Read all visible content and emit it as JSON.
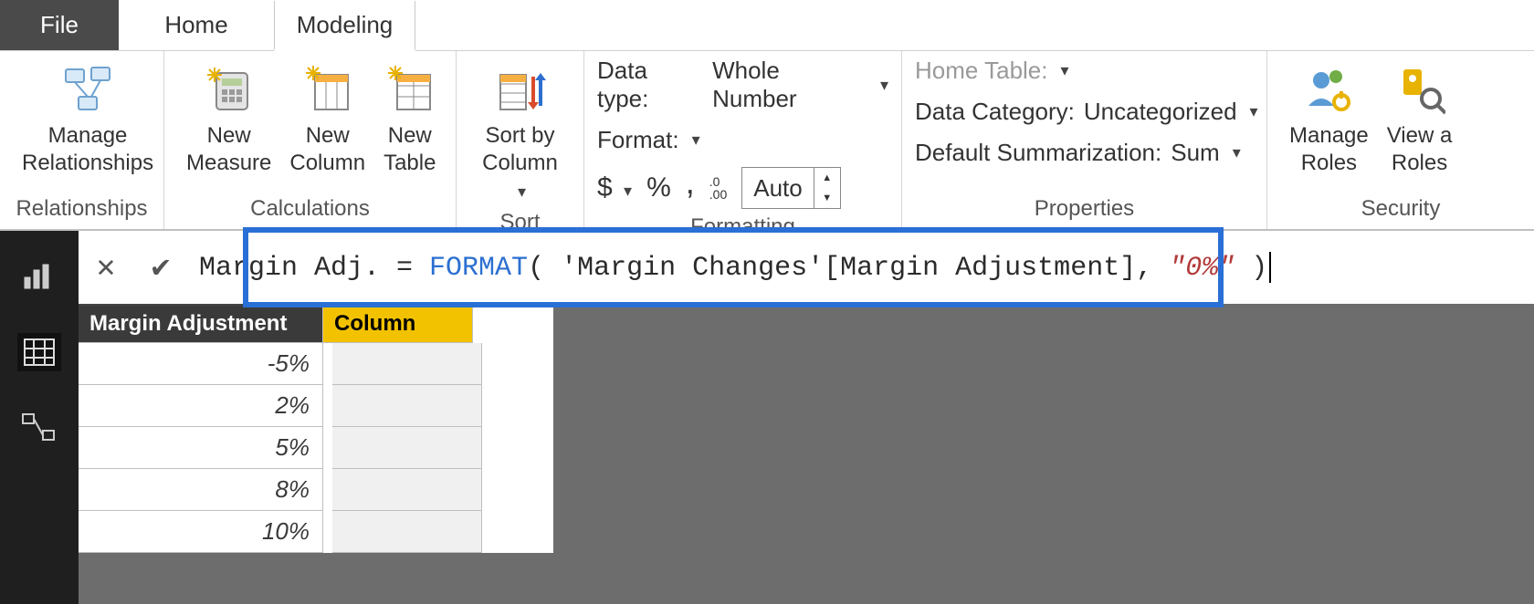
{
  "tabs": {
    "file": "File",
    "home": "Home",
    "modeling": "Modeling"
  },
  "ribbon": {
    "relationships": {
      "manage": "Manage\nRelationships",
      "group_label": "Relationships"
    },
    "calculations": {
      "new_measure": "New\nMeasure",
      "new_column": "New\nColumn",
      "new_table": "New\nTable",
      "group_label": "Calculations"
    },
    "sort": {
      "sort_by": "Sort by\nColumn",
      "group_label": "Sort"
    },
    "formatting": {
      "data_type_label": "Data type:",
      "data_type_value": "Whole Number",
      "format_label": "Format:",
      "currency": "$",
      "percent": "%",
      "thousands": ",",
      "decimals_icon": ".0\n.00",
      "auto": "Auto",
      "group_label": "Formatting"
    },
    "properties": {
      "home_table_label": "Home Table:",
      "data_category_label": "Data Category:",
      "data_category_value": "Uncategorized",
      "default_sum_label": "Default Summarization:",
      "default_sum_value": "Sum",
      "group_label": "Properties"
    },
    "security": {
      "manage_roles": "Manage\nRoles",
      "view_as": "View a\nRoles",
      "group_label": "Security"
    }
  },
  "formula": {
    "lhs": "Margin Adj. = ",
    "func": "FORMAT",
    "open": "(",
    "arg1": " 'Margin Changes'[Margin Adjustment], ",
    "str": "\"0%\"",
    "close": " )"
  },
  "grid": {
    "headers": {
      "col1": "Margin Adjustment",
      "col2": "Column"
    },
    "rows": [
      "-5%",
      "2%",
      "5%",
      "8%",
      "10%"
    ]
  },
  "chart_data": {
    "type": "table",
    "title": "Margin Adjustment",
    "columns": [
      "Margin Adjustment",
      "Column"
    ],
    "rows": [
      [
        "-5%",
        ""
      ],
      [
        "2%",
        ""
      ],
      [
        "5%",
        ""
      ],
      [
        "8%",
        ""
      ],
      [
        "10%",
        ""
      ]
    ]
  }
}
